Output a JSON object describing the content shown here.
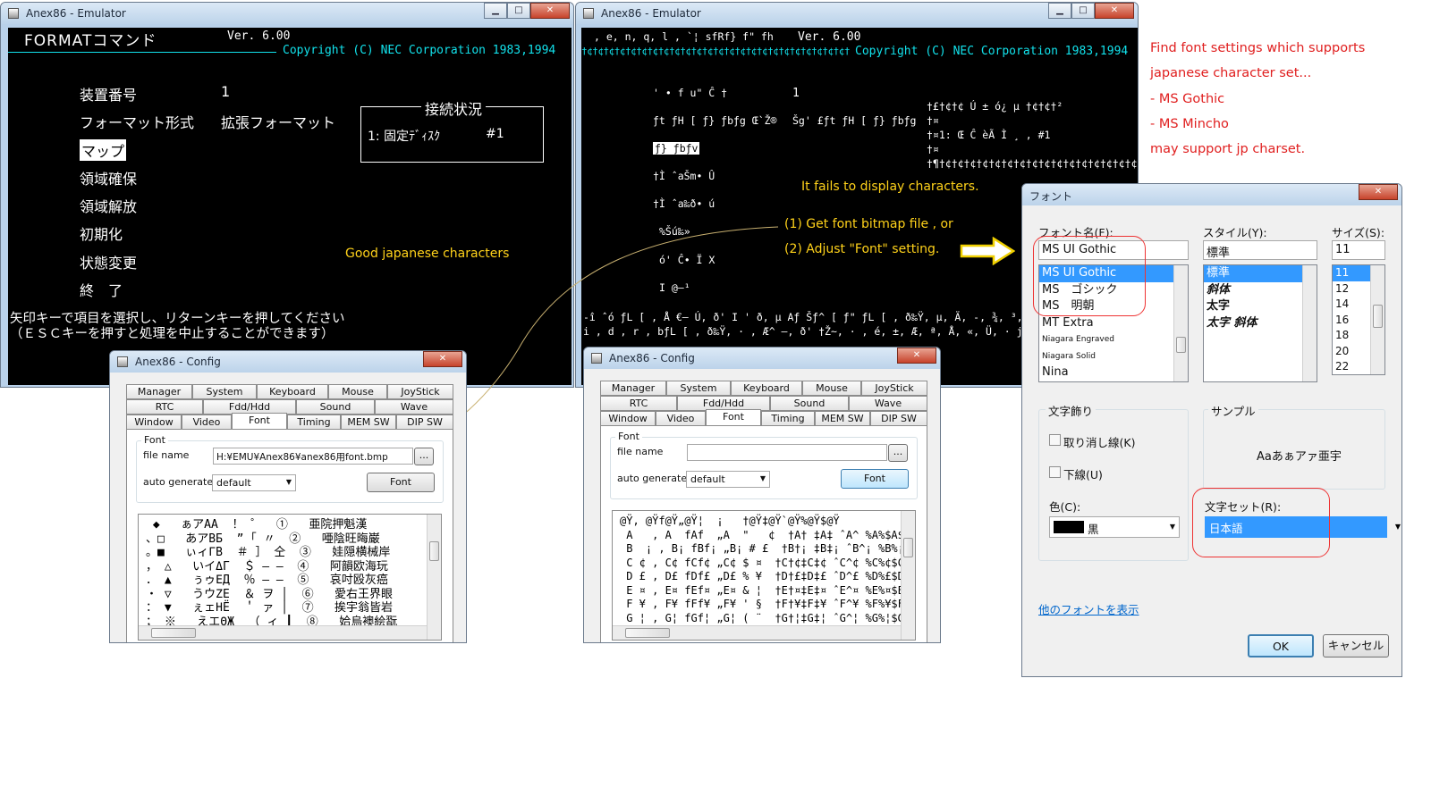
{
  "emu1": {
    "title": "Anex86 - Emulator",
    "header_left": "FORMATコマンド",
    "version": "Ver. 6.00",
    "copyright": "Copyright (C) NEC Corporation 1983,1994",
    "menu": [
      "装置番号",
      "フォーマット形式",
      "マップ",
      "領域確保",
      "領域解放",
      "初期化",
      "状態変更",
      "終　了"
    ],
    "device_value": "1",
    "format_value": "拡張フォーマット",
    "conn_title": "接続状況",
    "conn_line": "1:  固定ﾃﾞｨｽｸ",
    "conn_num": "#1",
    "instr1": "矢印キーで項目を選択し、リターンキーを押してください",
    "instr2": "（ＥＳＣキーを押すと処理を中止することができます）",
    "note": "Good japanese characters"
  },
  "emu2": {
    "title": "Anex86 - Emulator",
    "header_left": ", e, n, q, l , `¦ sfRf} f\" fh",
    "version": "Ver. 6.00",
    "dashes": "†¢†¢†¢†¢†¢†¢†¢†¢†¢†¢†¢†¢†¢†¢†¢†¢†¢†¢†¢†¢†¢†¢†¢†¢†¢†¢†¢†¢†¢†¢†¢†¢",
    "copyright": "Copyright (C) NEC Corporation 1983,1994",
    "menu": [
      "' • f u\" Ĉ †",
      "ƒt ƒH [ ƒ} ƒbƒg Œ`Ž®",
      "ƒ} ƒbƒv",
      "†Ì ˆaŠm• Û",
      "†Ì ˆa‰ð• ú",
      "%Šú‰»",
      "ó' Ĉ• Ï  X",
      "I   @—¹"
    ],
    "device_value": "1",
    "format_value": "Šg' £ƒt ƒH [ ƒ} ƒbƒg",
    "box_top": "†£†¢†¢         Ú ± ó¿ µ         †¢†¢†²",
    "box_mid1": "†¤",
    "box_mid2": "†¤1:  Œ Ĉ ѐÃ Ì ¸ ,              #1",
    "box_mid3": "†¤",
    "box_bot": "†¶†¢†¢†¢†¢†¢†¢†¢†¢†¢†¢†¢†¢†¢†¢†¢†¢†º",
    "instr1": "-î ˆó ƒL [ , Å  €– Ú, ð' I ' ð, µ  Aƒ Šƒ^  [ ƒ\" ƒL [ , ð‰Ÿ, µ, Ä, -, ¾, ³, ¢",
    "instr2": "  i , d , r , bƒL [ , ð‰Ÿ, · , Æ^ —, ð' †Ž~, · , é, ±, Æ, ª, Å, «, Ü, ·  j",
    "note_fail": "It fails to display characters.",
    "note_fix1": "(1) Get font bitmap file , or",
    "note_fix2": "(2) Adjust \"Font\" setting."
  },
  "cfg1": {
    "title": "Anex86 - Config",
    "tabs_row1": [
      "Manager",
      "System",
      "Keyboard",
      "Mouse",
      "JoyStick"
    ],
    "tabs_row2": [
      "RTC",
      "Fdd/Hdd",
      "Sound",
      "Wave"
    ],
    "tabs_row3": [
      "Window",
      "Video",
      "Font",
      "Timing",
      "MEM SW",
      "DIP SW"
    ],
    "group": "Font",
    "file_label": "file name",
    "file_value": "H:¥EMU¥Anex86¥anex86用font.bmp",
    "browse": "...",
    "auto_label": "auto generate",
    "auto_value": "default",
    "font_btn": "Font",
    "grid": " ◆   ぁアAA  ！ ゜  ①   亜院押魁漢\n、□   あアBБ  ” ｢ 〃  ②   唖陰旺晦巌\n。■   ぃィΓВ  ＃ ］ 仝  ③   娃隠横械岸\n， △   いイΔГ  ＄ ― ―  ④   阿韻欧海玩\n． ▲   ぅゥΕД  ％ ― ―  ⑤   哀吋殴灰癌\n・ ▽   うウΖЕ  ＆ ヲ │  ⑥   愛右王界眼\n： ▼   ぇェΗЁ  ＇ ァ │  ⑦   挨宇翁皆岩\n； ※   えエΘЖ  （ ィ ┃  ⑧   姶烏襖絵翫"
  },
  "cfg2": {
    "title": "Anex86 - Config",
    "tabs_row1": [
      "Manager",
      "System",
      "Keyboard",
      "Mouse",
      "JoyStick"
    ],
    "tabs_row2": [
      "RTC",
      "Fdd/Hdd",
      "Sound",
      "Wave"
    ],
    "tabs_row3": [
      "Window",
      "Video",
      "Font",
      "Timing",
      "MEM SW",
      "DIP SW"
    ],
    "group": "Font",
    "file_label": "file name",
    "file_value": "",
    "browse": "...",
    "auto_label": "auto generate",
    "auto_value": "default",
    "font_btn": "Font",
    "grid": "@Ÿ, @Ÿf@Ÿ„@Ÿ¦  ¡   †@Ÿ‡@Ÿ`@Ÿ%@Ÿ$@Ÿ\n A   , A  fAf  „A  \"   ¢  †A† ‡A‡ ˆA^ %A%$A$\n B  ¡ , B¡ fBf¡ „B¡ # £  †B†¡ ‡B‡¡ ˆB^¡ %B%¡$B$\n C ¢ , C¢ fCf¢ „C¢ $ ¤  †C†¢‡C‡¢ ˆC^¢ %C%¢$C$\n D £ , D£ fDf£ „D£ % ¥  †D†£‡D‡£ ˆD^£ %D%£$D$\n E ¤ , E¤ fEf¤ „E¤ & ¦  †E†¤‡E‡¤ ˆE^¤ %E%¤$E$\n F ¥ , F¥ fFf¥ „F¥ ' §  †F†¥‡F‡¥ ˆF^¥ %F%¥$F$\n G ¦ , G¦ fGf¦ „G¦ ( ¨  †G†¦‡G‡¦ ˆG^¦ %G%¦$G$"
  },
  "fontdlg": {
    "title": "フォント",
    "name_label": "フォント名(F):",
    "name_value": "MS UI Gothic",
    "names": [
      "MS UI Gothic",
      "MS　ゴシック",
      "MS　明朝",
      "MT Extra",
      "Niagara Engraved",
      "Niagara Solid",
      "Nina"
    ],
    "style_label": "スタイル(Y):",
    "style_value": "標準",
    "styles": [
      "標準",
      "斜体",
      "太字",
      "太字 斜体"
    ],
    "size_label": "サイズ(S):",
    "size_value": "11",
    "sizes": [
      "11",
      "12",
      "14",
      "16",
      "18",
      "20",
      "22"
    ],
    "effects_label": "文字飾り",
    "strike": "取り消し線(K)",
    "underline": "下線(U)",
    "color_label": "色(C):",
    "color_value": "黒",
    "sample_label": "サンプル",
    "sample_text": "Aaあぁアァ亜宇",
    "charset_label": "文字セット(R):",
    "charset_value": "日本語",
    "more_fonts": "他のフォントを表示",
    "ok": "OK",
    "cancel": "キャンセル"
  },
  "notes_right": [
    "Find font settings which supports",
    "japanese character set...",
    "- MS Gothic",
    "- MS Mincho",
    "may support jp charset."
  ],
  "colors": {
    "note_red": "#e02020",
    "note_yellow": "#ffd21a",
    "cyan": "#12e2ec",
    "select_blue": "#3399ff"
  }
}
